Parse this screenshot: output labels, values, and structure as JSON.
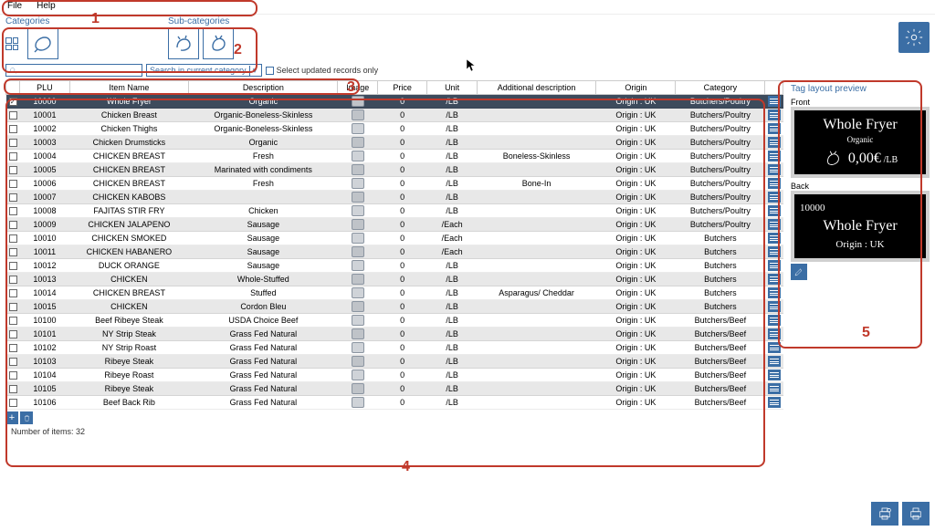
{
  "menu": {
    "file": "File",
    "help": "Help"
  },
  "categories": {
    "label": "Categories",
    "sub_label": "Sub-categories"
  },
  "search": {
    "placeholder": "",
    "scope_label": "Search in current category",
    "updated_only": "Select updated records only"
  },
  "columns": [
    "PLU",
    "Item Name",
    "Description",
    "Image",
    "Price",
    "Unit",
    "Additional description",
    "Origin",
    "Category"
  ],
  "rows": [
    {
      "plu": "10000",
      "name": "Whole Fryer",
      "desc": "Organic",
      "price": "0",
      "unit": "/LB",
      "add": "",
      "origin": "Origin : UK",
      "cat": "Butchers/Poultry",
      "sel": true
    },
    {
      "plu": "10001",
      "name": "Chicken Breast",
      "desc": "Organic-Boneless-Skinless",
      "price": "0",
      "unit": "/LB",
      "add": "",
      "origin": "Origin : UK",
      "cat": "Butchers/Poultry"
    },
    {
      "plu": "10002",
      "name": "Chicken Thighs",
      "desc": "Organic-Boneless-Skinless",
      "price": "0",
      "unit": "/LB",
      "add": "",
      "origin": "Origin : UK",
      "cat": "Butchers/Poultry"
    },
    {
      "plu": "10003",
      "name": "Chicken Drumsticks",
      "desc": "Organic",
      "price": "0",
      "unit": "/LB",
      "add": "",
      "origin": "Origin : UK",
      "cat": "Butchers/Poultry"
    },
    {
      "plu": "10004",
      "name": "CHICKEN BREAST",
      "desc": "Fresh",
      "price": "0",
      "unit": "/LB",
      "add": "Boneless-Skinless",
      "origin": "Origin : UK",
      "cat": "Butchers/Poultry"
    },
    {
      "plu": "10005",
      "name": "CHICKEN BREAST",
      "desc": "Marinated with condiments",
      "price": "0",
      "unit": "/LB",
      "add": "",
      "origin": "Origin : UK",
      "cat": "Butchers/Poultry"
    },
    {
      "plu": "10006",
      "name": "CHICKEN BREAST",
      "desc": "Fresh",
      "price": "0",
      "unit": "/LB",
      "add": "Bone-In",
      "origin": "Origin : UK",
      "cat": "Butchers/Poultry"
    },
    {
      "plu": "10007",
      "name": "CHICKEN KABOBS",
      "desc": "",
      "price": "0",
      "unit": "/LB",
      "add": "",
      "origin": "Origin : UK",
      "cat": "Butchers/Poultry"
    },
    {
      "plu": "10008",
      "name": "FAJITAS STIR FRY",
      "desc": "Chicken",
      "price": "0",
      "unit": "/LB",
      "add": "",
      "origin": "Origin : UK",
      "cat": "Butchers/Poultry"
    },
    {
      "plu": "10009",
      "name": "CHICKEN JALAPENO",
      "desc": "Sausage",
      "price": "0",
      "unit": "/Each",
      "add": "",
      "origin": "Origin : UK",
      "cat": "Butchers/Poultry"
    },
    {
      "plu": "10010",
      "name": "CHICKEN SMOKED",
      "desc": "Sausage",
      "price": "0",
      "unit": "/Each",
      "add": "",
      "origin": "Origin : UK",
      "cat": "Butchers"
    },
    {
      "plu": "10011",
      "name": "CHICKEN HABANERO",
      "desc": "Sausage",
      "price": "0",
      "unit": "/Each",
      "add": "",
      "origin": "Origin : UK",
      "cat": "Butchers"
    },
    {
      "plu": "10012",
      "name": "DUCK ORANGE",
      "desc": "Sausage",
      "price": "0",
      "unit": "/LB",
      "add": "",
      "origin": "Origin : UK",
      "cat": "Butchers"
    },
    {
      "plu": "10013",
      "name": "CHICKEN",
      "desc": "Whole-Stuffed",
      "price": "0",
      "unit": "/LB",
      "add": "",
      "origin": "Origin : UK",
      "cat": "Butchers"
    },
    {
      "plu": "10014",
      "name": "CHICKEN BREAST",
      "desc": "Stuffed",
      "price": "0",
      "unit": "/LB",
      "add": "Asparagus/ Cheddar",
      "origin": "Origin : UK",
      "cat": "Butchers"
    },
    {
      "plu": "10015",
      "name": "CHICKEN",
      "desc": "Cordon Bleu",
      "price": "0",
      "unit": "/LB",
      "add": "",
      "origin": "Origin : UK",
      "cat": "Butchers"
    },
    {
      "plu": "10100",
      "name": "Beef Ribeye Steak",
      "desc": "USDA Choice Beef",
      "price": "0",
      "unit": "/LB",
      "add": "",
      "origin": "Origin : UK",
      "cat": "Butchers/Beef"
    },
    {
      "plu": "10101",
      "name": "NY Strip Steak",
      "desc": "Grass Fed Natural",
      "price": "0",
      "unit": "/LB",
      "add": "",
      "origin": "Origin : UK",
      "cat": "Butchers/Beef"
    },
    {
      "plu": "10102",
      "name": "NY Strip Roast",
      "desc": "Grass Fed Natural",
      "price": "0",
      "unit": "/LB",
      "add": "",
      "origin": "Origin : UK",
      "cat": "Butchers/Beef"
    },
    {
      "plu": "10103",
      "name": "Ribeye Steak",
      "desc": "Grass Fed Natural",
      "price": "0",
      "unit": "/LB",
      "add": "",
      "origin": "Origin : UK",
      "cat": "Butchers/Beef"
    },
    {
      "plu": "10104",
      "name": "Ribeye Roast",
      "desc": "Grass Fed Natural",
      "price": "0",
      "unit": "/LB",
      "add": "",
      "origin": "Origin : UK",
      "cat": "Butchers/Beef"
    },
    {
      "plu": "10105",
      "name": "Ribeye Steak",
      "desc": "Grass Fed Natural",
      "price": "0",
      "unit": "/LB",
      "add": "",
      "origin": "Origin : UK",
      "cat": "Butchers/Beef"
    },
    {
      "plu": "10106",
      "name": "Beef Back Rib",
      "desc": "Grass Fed Natural",
      "price": "0",
      "unit": "/LB",
      "add": "",
      "origin": "Origin : UK",
      "cat": "Butchers/Beef"
    }
  ],
  "preview": {
    "title": "Tag layout preview",
    "front_label": "Front",
    "back_label": "Back",
    "front": {
      "name": "Whole Fryer",
      "sub": "Organic",
      "price": "0,00€",
      "unit": "/LB"
    },
    "back": {
      "plu": "10000",
      "name": "Whole Fryer",
      "origin": "Origin : UK"
    }
  },
  "status": "Number of items: 32",
  "annotations": {
    "n1": "1",
    "n2": "2",
    "n3": "3",
    "n4": "4",
    "n5": "5"
  }
}
